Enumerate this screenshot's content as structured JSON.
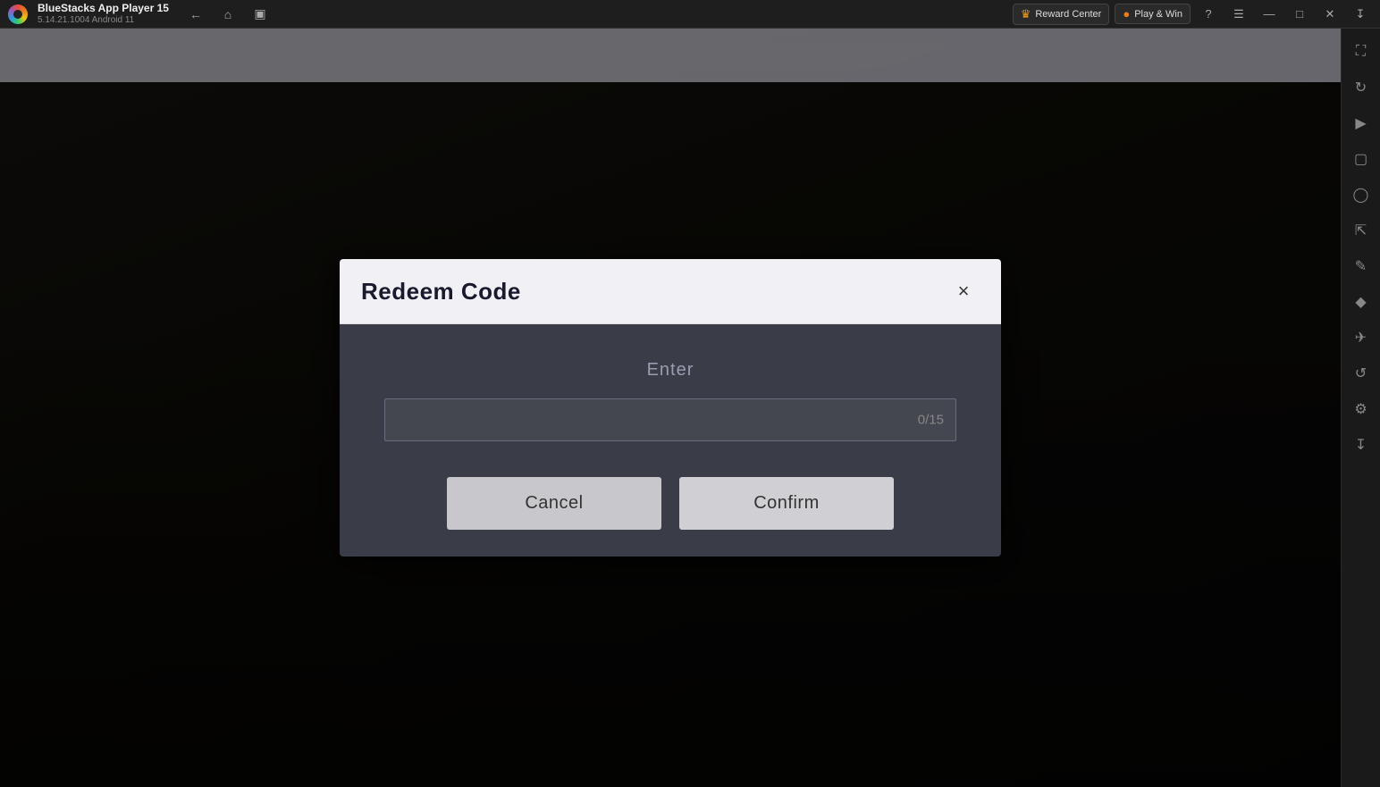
{
  "titlebar": {
    "app_name": "BlueStacks App Player 15",
    "version": "5.14.21.1004  Android 11",
    "reward_center_label": "Reward Center",
    "play_win_label": "Play & Win"
  },
  "modal": {
    "title": "Redeem Code",
    "close_label": "×",
    "enter_label": "Enter",
    "input_placeholder": "",
    "input_counter": "0/15",
    "cancel_label": "Cancel",
    "confirm_label": "Confirm"
  },
  "sidebar": {
    "icons": [
      "fullscreen-icon",
      "rotate-icon",
      "volume-icon",
      "screenshot-icon",
      "camera-icon",
      "resize-icon",
      "edit-icon",
      "eraser-icon",
      "refresh-icon",
      "settings-icon",
      "expand-icon"
    ]
  }
}
